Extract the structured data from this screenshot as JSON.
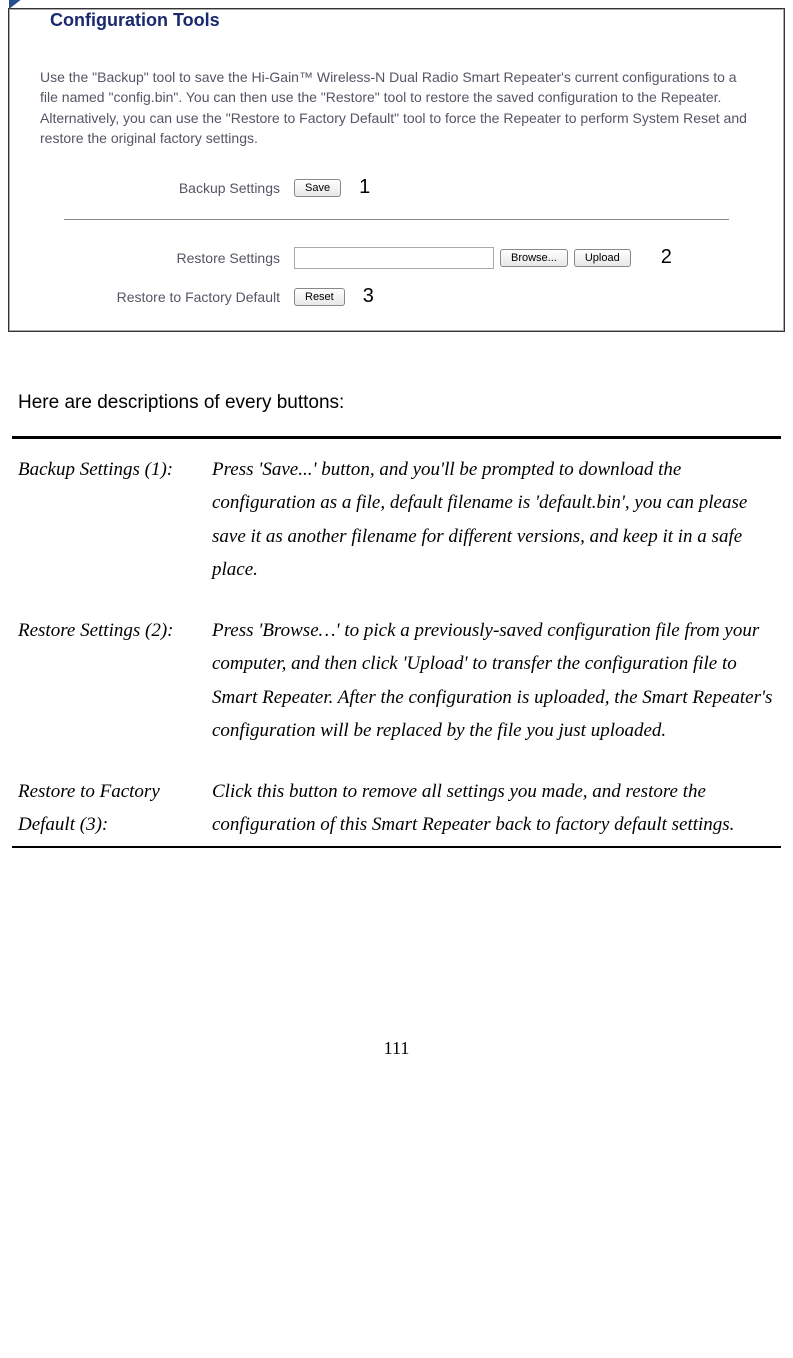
{
  "panel": {
    "title": "Configuration Tools",
    "description": "Use the \"Backup\" tool to save the Hi-Gain™ Wireless-N Dual Radio Smart Repeater's current configurations to a file named \"config.bin\". You can then use the \"Restore\" tool to restore the saved configuration to the Repeater. Alternatively, you can use the \"Restore to Factory Default\" tool to force the Repeater to perform System Reset and restore the original factory settings.",
    "rows": {
      "backup": {
        "label": "Backup Settings",
        "button": "Save",
        "annotation": "1"
      },
      "restore": {
        "label": "Restore Settings",
        "browse": "Browse...",
        "upload": "Upload",
        "annotation": "2",
        "file_value": ""
      },
      "factory": {
        "label": "Restore to Factory Default",
        "button": "Reset",
        "annotation": "3"
      }
    }
  },
  "descriptions_heading": "Here are descriptions of every buttons:",
  "descriptions": {
    "backup": {
      "title": "Backup Settings (1):",
      "body": "Press 'Save...' button, and you'll be prompted to download the configuration as a file, default filename is 'default.bin', you can please save it as another filename for different versions, and keep it in a safe place."
    },
    "restore": {
      "title": "Restore Settings (2):",
      "body": "Press 'Browse…' to pick a previously-saved configuration file from your computer, and then click 'Upload' to transfer the configuration file to Smart Repeater. After the configuration is uploaded, the Smart Repeater's configuration will be replaced by the file you just uploaded."
    },
    "factory": {
      "title": "Restore to Factory Default (3):",
      "body": "Click this button to remove all settings you made, and restore the configuration of this Smart Repeater back to factory default settings."
    }
  },
  "page_number": "111"
}
